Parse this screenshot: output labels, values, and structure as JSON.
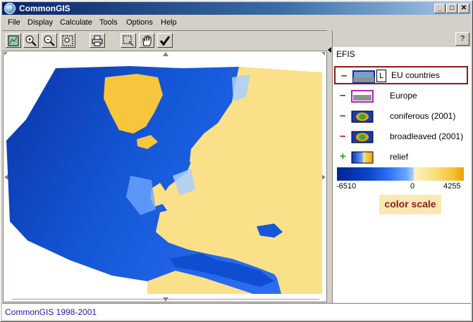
{
  "window": {
    "title": "CommonGIS",
    "icon_label": "cG",
    "minimize_glyph": "_",
    "maximize_glyph": "□",
    "close_glyph": "✕"
  },
  "menu": [
    "File",
    "Display",
    "Calculate",
    "Tools",
    "Options",
    "Help"
  ],
  "toolbar": {
    "buttons": [
      "map-extent",
      "zoom-in",
      "zoom-out",
      "zoom-window",
      "print",
      "select-rectangle",
      "pan-hand",
      "apply-check"
    ]
  },
  "legend": {
    "help_label": "?",
    "title": "EFIS",
    "layers": [
      {
        "sign": "–",
        "label": "EU countries",
        "selected": true,
        "l_box": "L"
      },
      {
        "sign": "–",
        "label": "Europe",
        "selected": false
      },
      {
        "sign": "–",
        "label": "coniferous (2001)",
        "selected": false
      },
      {
        "sign": "–",
        "label": "broadleaved (2001)",
        "selected": false
      },
      {
        "sign": "+",
        "label": "relief",
        "selected": false
      }
    ],
    "scale": {
      "min_label": "-6510",
      "mid_label": "0",
      "max_label": "4255",
      "caption": "color scale"
    }
  },
  "status": {
    "text": "CommonGIS 1998-2001"
  },
  "colors": {
    "sea_deep": "#0a3fb0",
    "sea_shallow": "#6ea6ff",
    "land": "#fbe08a",
    "selection": "#8b1a1a"
  }
}
